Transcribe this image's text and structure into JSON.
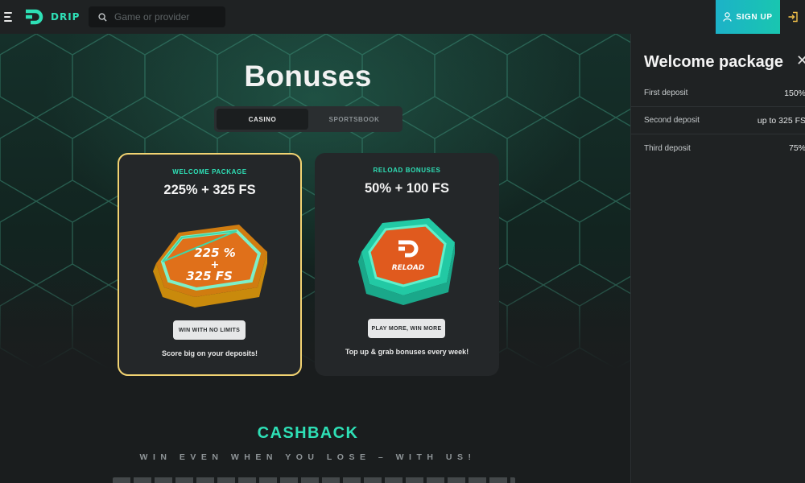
{
  "header": {
    "brand": "DRIP",
    "search_placeholder": "Game or provider",
    "signup_label": "SIGN UP"
  },
  "main": {
    "title": "Bonuses",
    "tabs": [
      {
        "label": "CASINO",
        "active": true
      },
      {
        "label": "SPORTSBOOK",
        "active": false
      }
    ],
    "cards": [
      {
        "kicker": "WELCOME PACKAGE",
        "title": "225% + 325 FS",
        "art_text_line1": "225 %",
        "art_text_line2": "+",
        "art_text_line3": "325 FS",
        "button": "WIN WITH NO LIMITS",
        "description": "Score big on your deposits!"
      },
      {
        "kicker": "RELOAD BONUSES",
        "title": "50% + 100 FS",
        "art_text": "RELOAD",
        "button": "PLAY MORE, WIN MORE",
        "description": "Top up & grab bonuses every week!"
      }
    ],
    "cashback": {
      "title": "CASHBACK",
      "subtitle": "WIN EVEN WHEN YOU LOSE – WITH US!"
    }
  },
  "panel": {
    "title": "Welcome package",
    "rows": [
      {
        "label": "First deposit",
        "value": "150%"
      },
      {
        "label": "Second deposit",
        "value": "up to 325 FS"
      },
      {
        "label": "Third deposit",
        "value": "75%"
      }
    ]
  },
  "colors": {
    "accent": "#2ee0b6",
    "highlight_border": "#f2d372",
    "signup_gradient": [
      "#1cb2c8",
      "#19c6b0"
    ],
    "background": "#1a1d1e"
  }
}
